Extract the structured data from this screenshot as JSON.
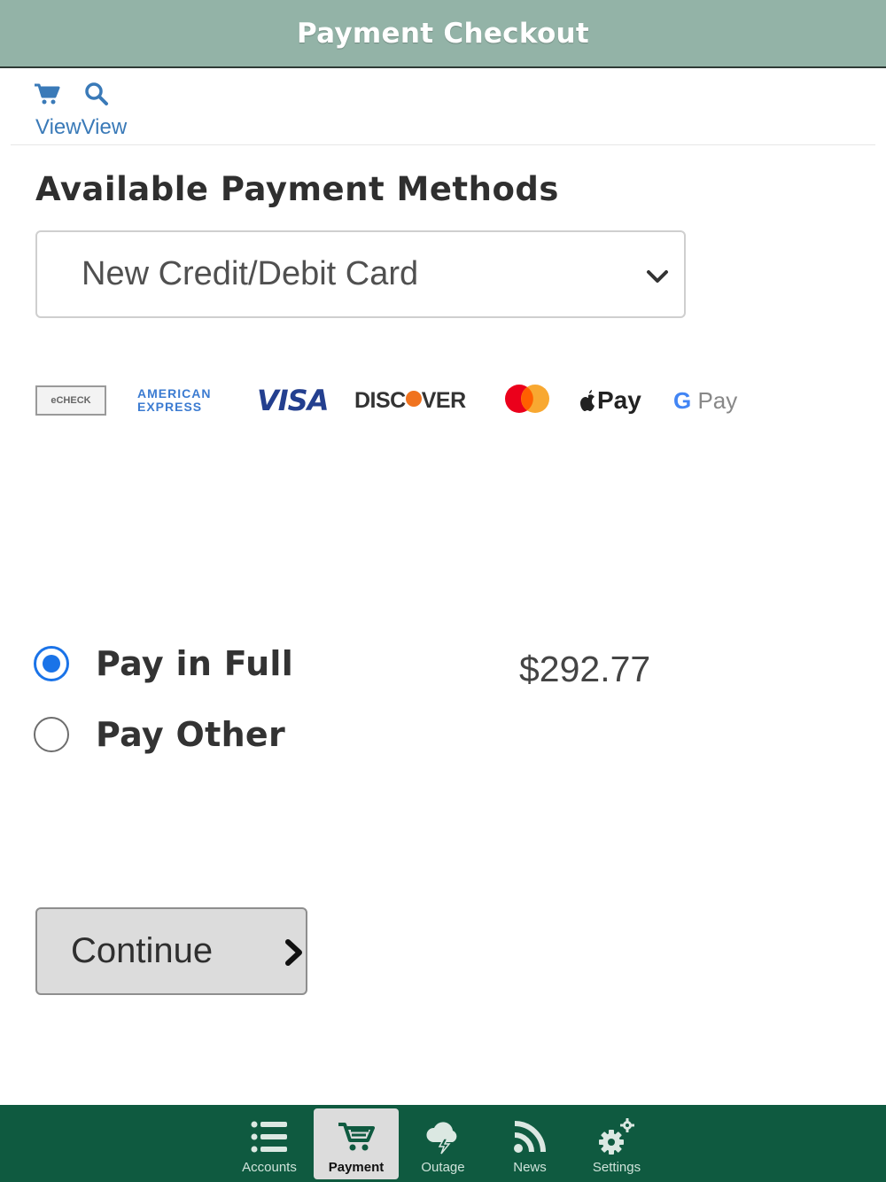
{
  "header": {
    "title": "Payment Checkout"
  },
  "toolbar": {
    "icons": [
      "cart-icon",
      "search-icon"
    ],
    "view_links": [
      "View",
      "View"
    ]
  },
  "payment_methods": {
    "title": "Available Payment Methods",
    "selected": "New Credit/Debit Card",
    "accepted_cards": [
      "eCheck",
      "American Express",
      "VISA",
      "Discover",
      "Mastercard",
      "Apple Pay",
      "Google Pay"
    ],
    "card_texts": {
      "echeck": "eCHECK",
      "amex_line1": "AMERICAN",
      "amex_line2": "EXPRESS",
      "visa": "VISA",
      "discover_left": "DISC",
      "discover_right": "VER",
      "applepay": "Pay",
      "gpay_g": "G",
      "gpay": "Pay"
    }
  },
  "options": {
    "pay_in_full": {
      "label": "Pay in Full",
      "selected": true,
      "amount": "$292.77"
    },
    "pay_other": {
      "label": "Pay Other",
      "selected": false
    }
  },
  "actions": {
    "continue_label": "Continue"
  },
  "nav": {
    "items": [
      {
        "label": "Accounts",
        "icon": "list-icon",
        "active": false
      },
      {
        "label": "Payment",
        "icon": "cart-icon",
        "active": true
      },
      {
        "label": "Outage",
        "icon": "storm-cloud-icon",
        "active": false
      },
      {
        "label": "News",
        "icon": "rss-icon",
        "active": false
      },
      {
        "label": "Settings",
        "icon": "gears-icon",
        "active": false
      }
    ]
  },
  "colors": {
    "header": "#93b3a7",
    "nav": "#0f5a40",
    "link": "#3a7ab8",
    "radio": "#1a73e8"
  }
}
